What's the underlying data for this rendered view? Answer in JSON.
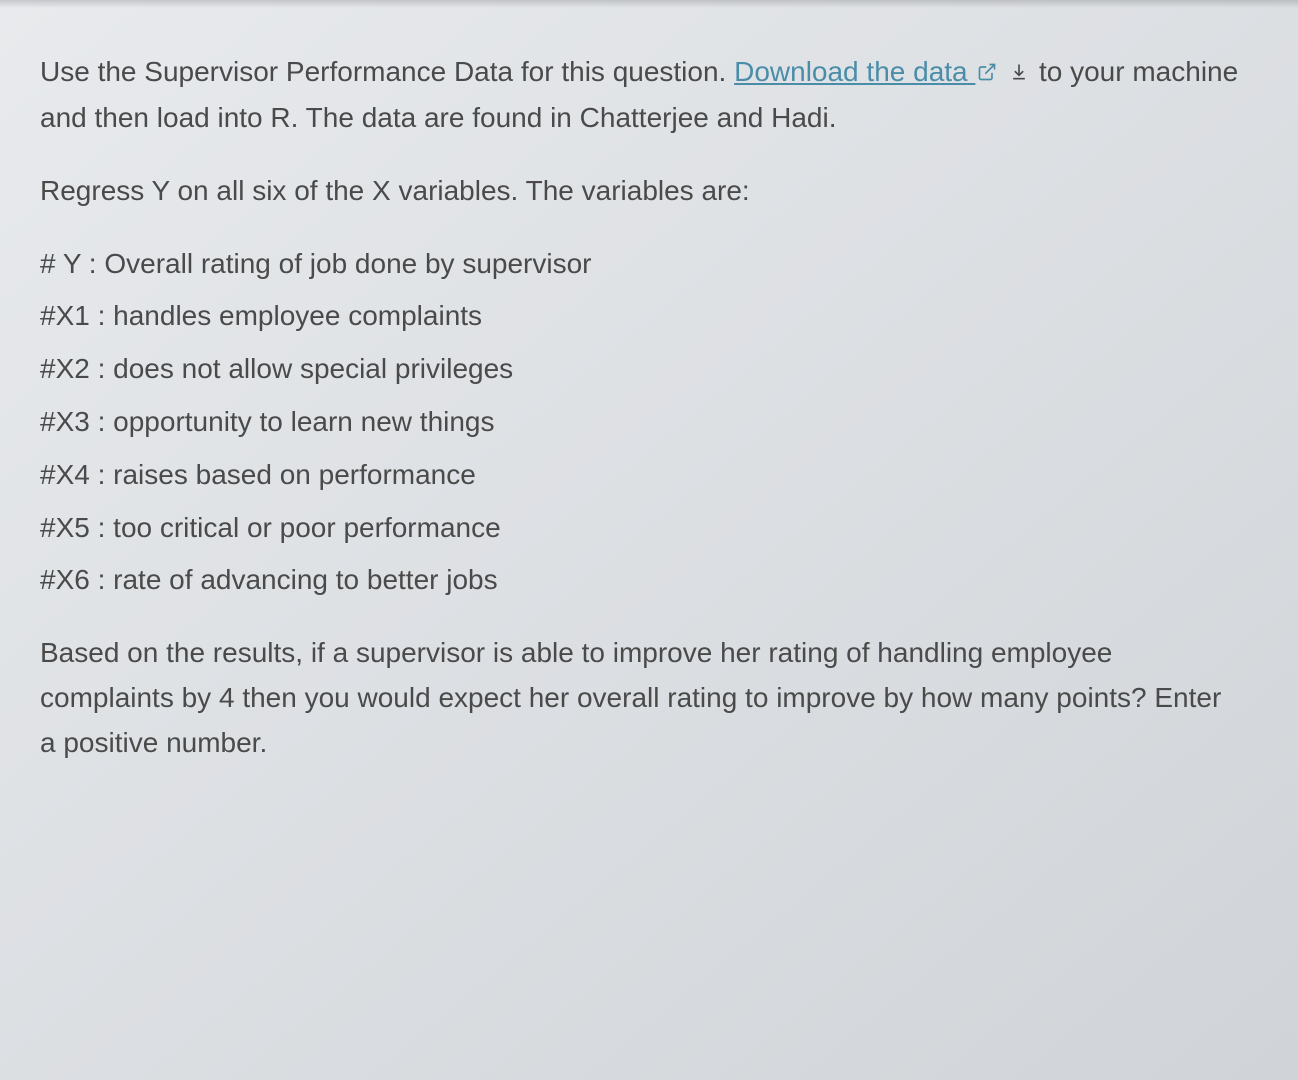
{
  "intro": {
    "part1": "Use the Supervisor Performance Data for this question. ",
    "link_text": "Download the data",
    "part2": " to your machine and then load into R. The data are found in Chatterjee and Hadi."
  },
  "instruction": "Regress Y on all six of the X variables. The variables are:",
  "variables": [
    "# Y : Overall rating of job done by supervisor",
    "#X1 : handles employee complaints",
    "#X2 : does not allow special privileges",
    "#X3 : opportunity to learn new things",
    "#X4 : raises based on performance",
    "#X5 : too critical or poor performance",
    "#X6 : rate of advancing to better jobs"
  ],
  "question": "Based on the results, if a supervisor is able to improve her rating of handling employee complaints by 4 then you would expect her overall rating to improve by how many points? Enter a positive number."
}
